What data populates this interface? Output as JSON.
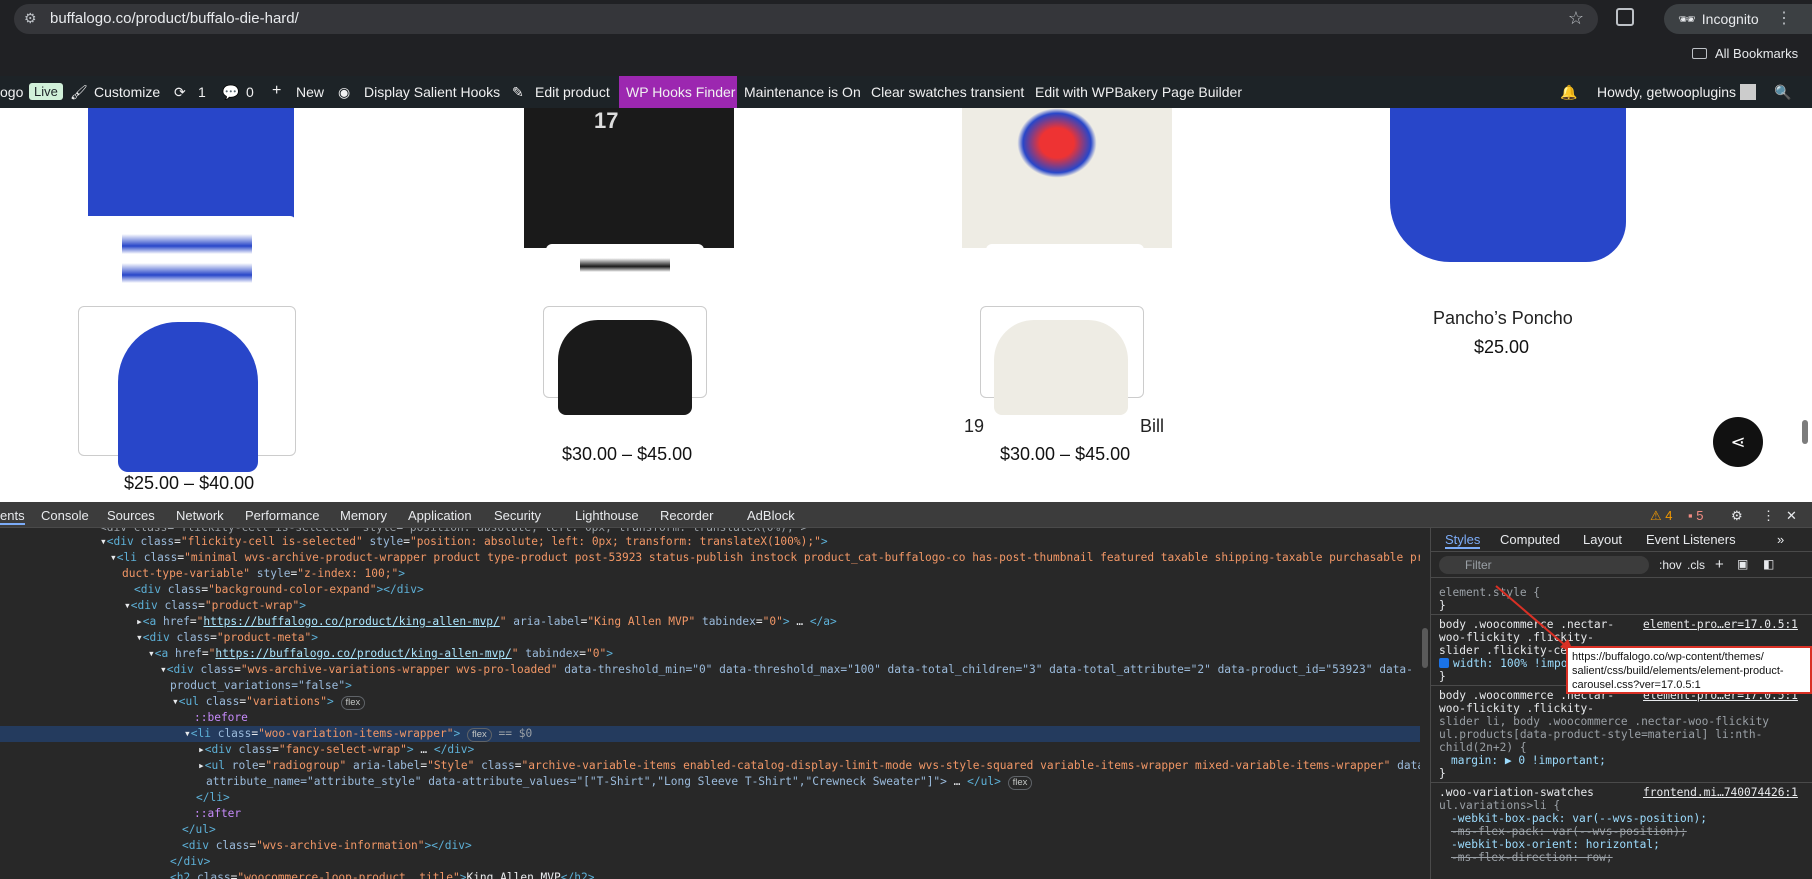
{
  "browser": {
    "url": "buffalogo.co/product/buffalo-die-hard/",
    "profile": "Incognito",
    "bookmarks_label": "All Bookmarks"
  },
  "adminbar": {
    "site": "ogo",
    "live": "Live",
    "customize": "Customize",
    "updates": "1",
    "comments": "0",
    "new": "New",
    "salient": "Display Salient Hooks",
    "edit_product": "Edit product",
    "hooks_finder": "WP Hooks Finder",
    "maintenance": "Maintenance is On",
    "clear_swatches": "Clear swatches transient",
    "wpbakery": "Edit with WPBakery Page Builder",
    "howdy": "Howdy, getwooplugins"
  },
  "products": [
    {
      "title": "",
      "price": "$25.00 – $40.00"
    },
    {
      "title": "",
      "price": "$30.00 – $45.00"
    },
    {
      "title": "19",
      "title_end": "Bill",
      "price": "$30.00 – $45.00"
    },
    {
      "title": "Pancho’s Poncho",
      "price": "$25.00"
    }
  ],
  "devtools": {
    "tabs": [
      "ents",
      "Console",
      "Sources",
      "Network",
      "Performance",
      "Memory",
      "Application",
      "Security",
      "Lighthouse",
      "Recorder",
      "AdBlock"
    ],
    "warnings": "4",
    "issues": "5",
    "dom": {
      "l0": "<div class=\"flickity-cell is-selected\" style=\"position: absolute; left: 0px; transform: translateX(0%);\">",
      "l1a": "flickity-cell is-selected",
      "l1b": "position: absolute; left: 0px; transform: translateX(100%);",
      "l2a": "minimal wvs-archive-product-wrapper product type-product post-53923 status-publish instock product_cat-buffalogo-co has-post-thumbnail featured taxable shipping-taxable purchasable pro",
      "l2b": "duct-type-variable",
      "l2c": "z-index: 100;",
      "l3": "background-color-expand",
      "l4": "product-wrap",
      "l5href": "https://buffalogo.co/product/king-allen-mvp/",
      "l5label": "King Allen MVP",
      "l5tab": "0",
      "l6": "product-meta",
      "l7href": "https://buffalogo.co/product/king-allen-mvp/",
      "l7tab": "0",
      "l8a": "wvs-archive-variations-wrapper wvs-pro-loaded",
      "l8b": "data-threshold_min=\"0\" data-threshold_max=\"100\" data-total_children=\"3\" data-total_attribute=\"2\" data-product_id=\"53923\" data-",
      "l8c": "product_variations=\"false\"",
      "l9": "variations",
      "l10": "::before",
      "l11": "woo-variation-items-wrapper",
      "l11eq": "== $0",
      "l12": "fancy-select-wrap",
      "l13a": "radiogroup",
      "l13b": "Style",
      "l13c": "archive-variable-items enabled-catalog-display-limit-mode wvs-style-squared variable-items-wrapper mixed-variable-items-wrapper",
      "l13d": "attribute_name=\"attribute_style\" data-attribute_values=\"[\"T-Shirt\",\"Long Sleeve T-Shirt\",\"Crewneck Sweater\"]\">",
      "l15": "::after",
      "l17": "wvs-archive-information",
      "l19": "woocommerce-loop-product__title",
      "l19t": "King Allen MVP",
      "flex": "flex"
    },
    "styles": {
      "tabs": [
        "Styles",
        "Computed",
        "Layout",
        "Event Listeners"
      ],
      "filter": "Filter",
      "hov": ":hov",
      "cls": ".cls",
      "element_style": "element.style {",
      "rule1_sel": [
        "body .woocommerce .nectar-",
        "woo-flickity .flickity-",
        "slider .flickity-ce"
      ],
      "rule1_src": "element-pro…er=17.0.5:1",
      "rule1_prop": "width: 100% !impo",
      "rule2_sel": [
        "body .woocommerce .nectar-",
        "woo-flickity .flickity-",
        "slider li, body .woocommerce .nectar-woo-flickity",
        "ul.products[data-product-style=material] li:nth-",
        "child(2n+2) {"
      ],
      "rule2_src": "element-pro…er=17.0.5:1",
      "rule2_prop": "margin: ▶ 0 !important;",
      "rule3_sel": [
        ".woo-variation-swatches",
        "ul.variations>li {"
      ],
      "rule3_src": "frontend.mi…740074426:1",
      "rule3_props": [
        "-webkit-box-pack: var(--wvs-position);",
        "-ms-flex-pack: var(--wvs-position);",
        "-webkit-box-orient: horizontal;",
        "-ms-flex-direction: row;"
      ],
      "tooltip": [
        "https://buffalogo.co/wp-content/themes/",
        "salient/css/build/elements/element-product-",
        "carousel.css?ver=17.0.5:1"
      ]
    }
  }
}
